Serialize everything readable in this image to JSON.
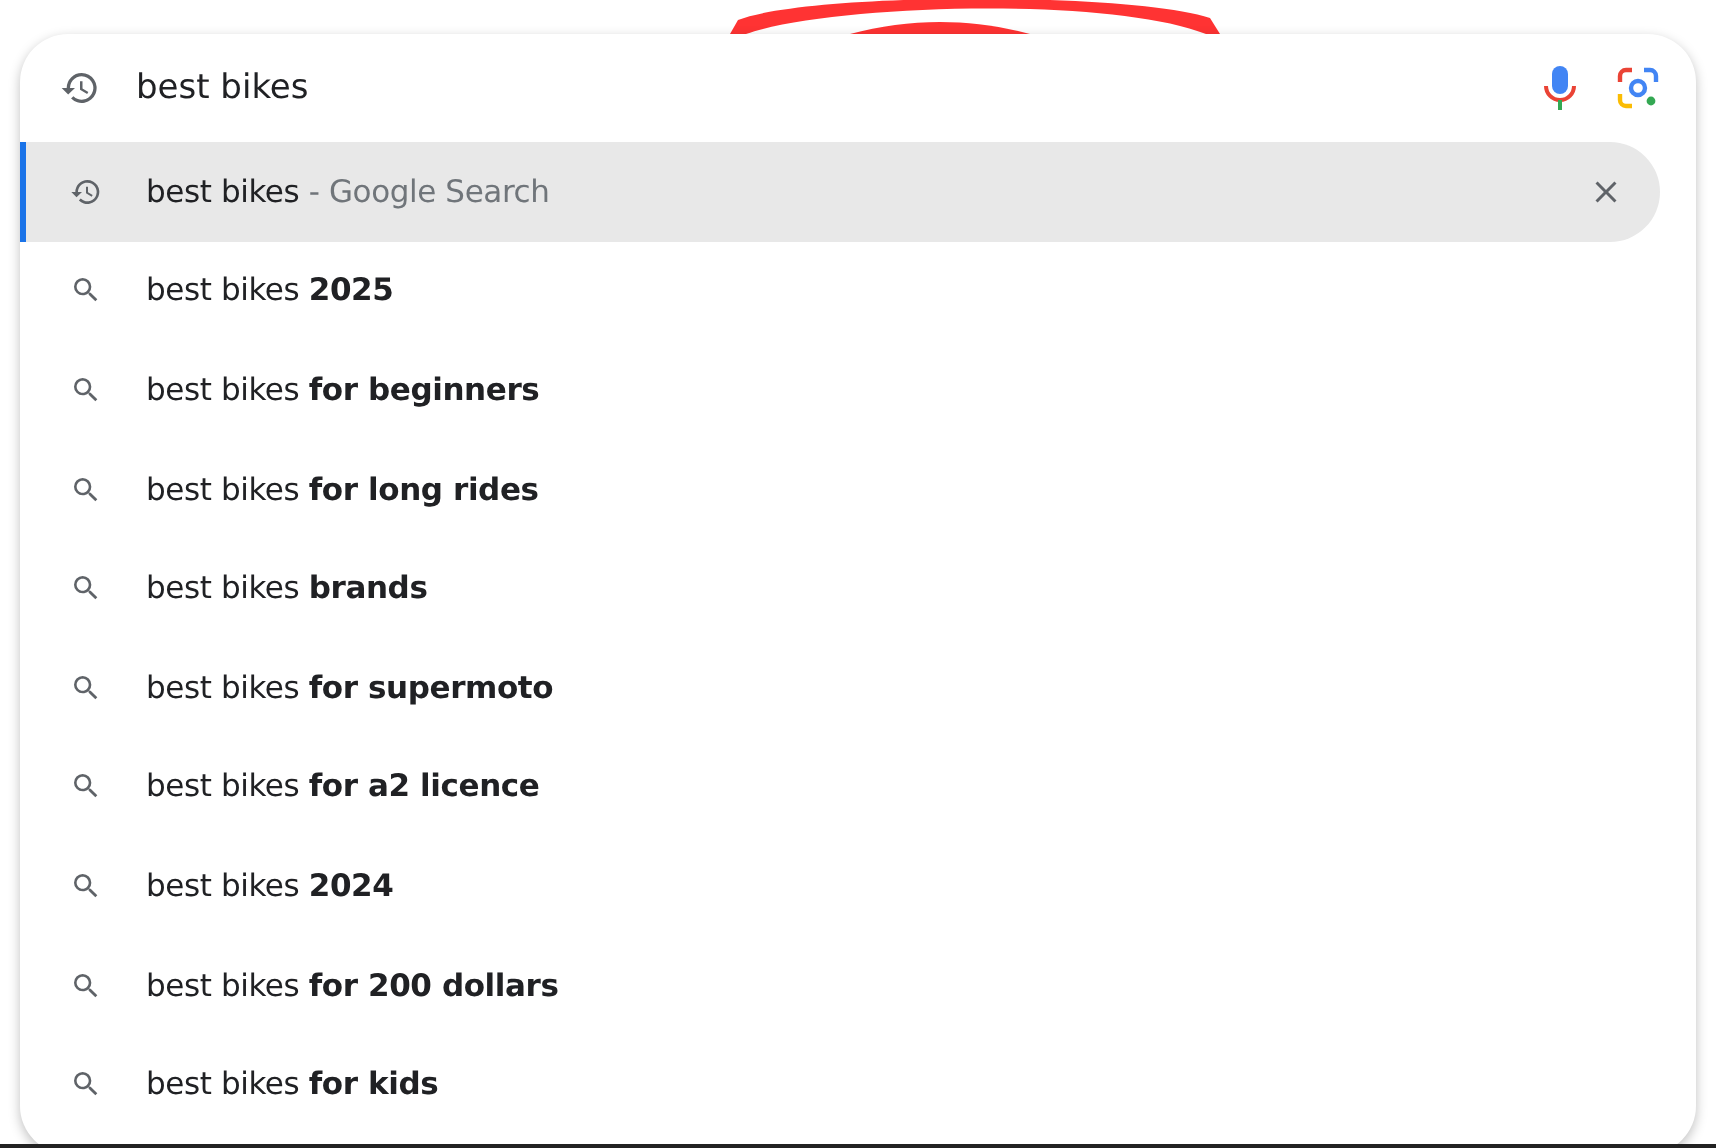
{
  "search": {
    "value": "best bikes"
  },
  "suggestions": [
    {
      "kind": "history",
      "text": "best bikes",
      "suffix": "- Google Search",
      "selected": true
    },
    {
      "kind": "search",
      "text": "best bikes **2025**",
      "selected": false
    },
    {
      "kind": "search",
      "text": "best bikes **for beginners**",
      "selected": false
    },
    {
      "kind": "search",
      "text": "best bikes **for long rides**",
      "selected": false
    },
    {
      "kind": "search",
      "text": "best bikes **brands**",
      "selected": false
    },
    {
      "kind": "search",
      "text": "best bikes **for supermoto**",
      "selected": false
    },
    {
      "kind": "search",
      "text": "best bikes **for a2 licence**",
      "selected": false
    },
    {
      "kind": "search",
      "text": "best bikes **2024**",
      "selected": false
    },
    {
      "kind": "search",
      "text": "best bikes **for 200 dollars**",
      "selected": false
    },
    {
      "kind": "search",
      "text": "best bikes **for kids**",
      "selected": false
    }
  ]
}
